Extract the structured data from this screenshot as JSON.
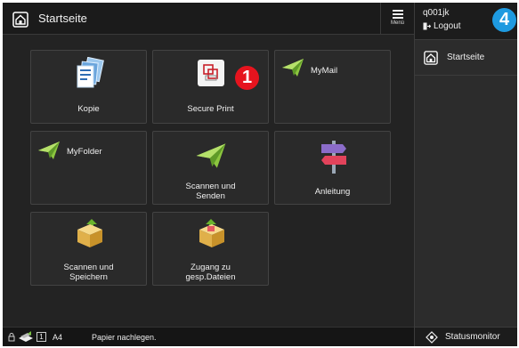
{
  "header": {
    "title": "Startseite",
    "menu_label": "Menü"
  },
  "user": {
    "name": "q001jk",
    "logout_label": "Logout"
  },
  "sidebar": {
    "home_label": "Startseite",
    "status_monitor_label": "Statusmonitor"
  },
  "badges": {
    "secure_print": "1",
    "user_area": "4"
  },
  "tiles": [
    {
      "label": "Kopie"
    },
    {
      "label": "Secure Print"
    },
    {
      "label": "MyMail"
    },
    {
      "label": "MyFolder"
    },
    {
      "label_line1": "Scannen und",
      "label_line2": "Senden"
    },
    {
      "label": "Anleitung"
    },
    {
      "label_line1": "Scannen und",
      "label_line2": "Speichern"
    },
    {
      "label_line1": "Zugang zu",
      "label_line2": "gesp.Dateien"
    }
  ],
  "status": {
    "tray_number": "1",
    "paper_size": "A4",
    "message": "Papier nachlegen."
  },
  "colors": {
    "badge_red": "#e6141e",
    "badge_blue": "#1e9ae0",
    "background": "#232323",
    "accent_green": "#7ac143"
  }
}
